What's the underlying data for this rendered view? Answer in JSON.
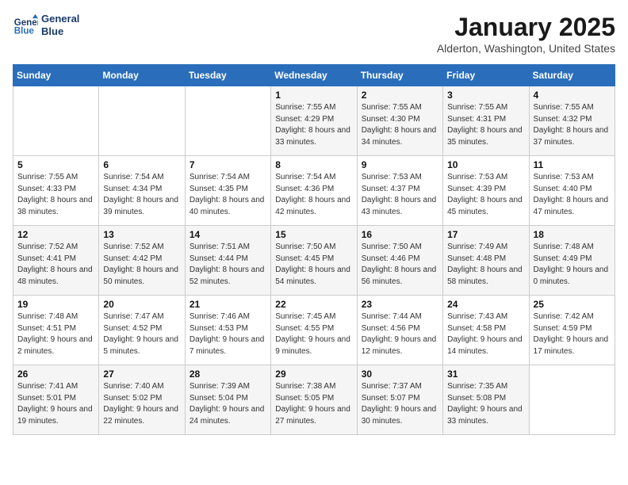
{
  "header": {
    "logo_line1": "General",
    "logo_line2": "Blue",
    "month": "January 2025",
    "location": "Alderton, Washington, United States"
  },
  "weekdays": [
    "Sunday",
    "Monday",
    "Tuesday",
    "Wednesday",
    "Thursday",
    "Friday",
    "Saturday"
  ],
  "weeks": [
    [
      {
        "day": "",
        "sunrise": "",
        "sunset": "",
        "daylight": ""
      },
      {
        "day": "",
        "sunrise": "",
        "sunset": "",
        "daylight": ""
      },
      {
        "day": "",
        "sunrise": "",
        "sunset": "",
        "daylight": ""
      },
      {
        "day": "1",
        "sunrise": "Sunrise: 7:55 AM",
        "sunset": "Sunset: 4:29 PM",
        "daylight": "Daylight: 8 hours and 33 minutes."
      },
      {
        "day": "2",
        "sunrise": "Sunrise: 7:55 AM",
        "sunset": "Sunset: 4:30 PM",
        "daylight": "Daylight: 8 hours and 34 minutes."
      },
      {
        "day": "3",
        "sunrise": "Sunrise: 7:55 AM",
        "sunset": "Sunset: 4:31 PM",
        "daylight": "Daylight: 8 hours and 35 minutes."
      },
      {
        "day": "4",
        "sunrise": "Sunrise: 7:55 AM",
        "sunset": "Sunset: 4:32 PM",
        "daylight": "Daylight: 8 hours and 37 minutes."
      }
    ],
    [
      {
        "day": "5",
        "sunrise": "Sunrise: 7:55 AM",
        "sunset": "Sunset: 4:33 PM",
        "daylight": "Daylight: 8 hours and 38 minutes."
      },
      {
        "day": "6",
        "sunrise": "Sunrise: 7:54 AM",
        "sunset": "Sunset: 4:34 PM",
        "daylight": "Daylight: 8 hours and 39 minutes."
      },
      {
        "day": "7",
        "sunrise": "Sunrise: 7:54 AM",
        "sunset": "Sunset: 4:35 PM",
        "daylight": "Daylight: 8 hours and 40 minutes."
      },
      {
        "day": "8",
        "sunrise": "Sunrise: 7:54 AM",
        "sunset": "Sunset: 4:36 PM",
        "daylight": "Daylight: 8 hours and 42 minutes."
      },
      {
        "day": "9",
        "sunrise": "Sunrise: 7:53 AM",
        "sunset": "Sunset: 4:37 PM",
        "daylight": "Daylight: 8 hours and 43 minutes."
      },
      {
        "day": "10",
        "sunrise": "Sunrise: 7:53 AM",
        "sunset": "Sunset: 4:39 PM",
        "daylight": "Daylight: 8 hours and 45 minutes."
      },
      {
        "day": "11",
        "sunrise": "Sunrise: 7:53 AM",
        "sunset": "Sunset: 4:40 PM",
        "daylight": "Daylight: 8 hours and 47 minutes."
      }
    ],
    [
      {
        "day": "12",
        "sunrise": "Sunrise: 7:52 AM",
        "sunset": "Sunset: 4:41 PM",
        "daylight": "Daylight: 8 hours and 48 minutes."
      },
      {
        "day": "13",
        "sunrise": "Sunrise: 7:52 AM",
        "sunset": "Sunset: 4:42 PM",
        "daylight": "Daylight: 8 hours and 50 minutes."
      },
      {
        "day": "14",
        "sunrise": "Sunrise: 7:51 AM",
        "sunset": "Sunset: 4:44 PM",
        "daylight": "Daylight: 8 hours and 52 minutes."
      },
      {
        "day": "15",
        "sunrise": "Sunrise: 7:50 AM",
        "sunset": "Sunset: 4:45 PM",
        "daylight": "Daylight: 8 hours and 54 minutes."
      },
      {
        "day": "16",
        "sunrise": "Sunrise: 7:50 AM",
        "sunset": "Sunset: 4:46 PM",
        "daylight": "Daylight: 8 hours and 56 minutes."
      },
      {
        "day": "17",
        "sunrise": "Sunrise: 7:49 AM",
        "sunset": "Sunset: 4:48 PM",
        "daylight": "Daylight: 8 hours and 58 minutes."
      },
      {
        "day": "18",
        "sunrise": "Sunrise: 7:48 AM",
        "sunset": "Sunset: 4:49 PM",
        "daylight": "Daylight: 9 hours and 0 minutes."
      }
    ],
    [
      {
        "day": "19",
        "sunrise": "Sunrise: 7:48 AM",
        "sunset": "Sunset: 4:51 PM",
        "daylight": "Daylight: 9 hours and 2 minutes."
      },
      {
        "day": "20",
        "sunrise": "Sunrise: 7:47 AM",
        "sunset": "Sunset: 4:52 PM",
        "daylight": "Daylight: 9 hours and 5 minutes."
      },
      {
        "day": "21",
        "sunrise": "Sunrise: 7:46 AM",
        "sunset": "Sunset: 4:53 PM",
        "daylight": "Daylight: 9 hours and 7 minutes."
      },
      {
        "day": "22",
        "sunrise": "Sunrise: 7:45 AM",
        "sunset": "Sunset: 4:55 PM",
        "daylight": "Daylight: 9 hours and 9 minutes."
      },
      {
        "day": "23",
        "sunrise": "Sunrise: 7:44 AM",
        "sunset": "Sunset: 4:56 PM",
        "daylight": "Daylight: 9 hours and 12 minutes."
      },
      {
        "day": "24",
        "sunrise": "Sunrise: 7:43 AM",
        "sunset": "Sunset: 4:58 PM",
        "daylight": "Daylight: 9 hours and 14 minutes."
      },
      {
        "day": "25",
        "sunrise": "Sunrise: 7:42 AM",
        "sunset": "Sunset: 4:59 PM",
        "daylight": "Daylight: 9 hours and 17 minutes."
      }
    ],
    [
      {
        "day": "26",
        "sunrise": "Sunrise: 7:41 AM",
        "sunset": "Sunset: 5:01 PM",
        "daylight": "Daylight: 9 hours and 19 minutes."
      },
      {
        "day": "27",
        "sunrise": "Sunrise: 7:40 AM",
        "sunset": "Sunset: 5:02 PM",
        "daylight": "Daylight: 9 hours and 22 minutes."
      },
      {
        "day": "28",
        "sunrise": "Sunrise: 7:39 AM",
        "sunset": "Sunset: 5:04 PM",
        "daylight": "Daylight: 9 hours and 24 minutes."
      },
      {
        "day": "29",
        "sunrise": "Sunrise: 7:38 AM",
        "sunset": "Sunset: 5:05 PM",
        "daylight": "Daylight: 9 hours and 27 minutes."
      },
      {
        "day": "30",
        "sunrise": "Sunrise: 7:37 AM",
        "sunset": "Sunset: 5:07 PM",
        "daylight": "Daylight: 9 hours and 30 minutes."
      },
      {
        "day": "31",
        "sunrise": "Sunrise: 7:35 AM",
        "sunset": "Sunset: 5:08 PM",
        "daylight": "Daylight: 9 hours and 33 minutes."
      },
      {
        "day": "",
        "sunrise": "",
        "sunset": "",
        "daylight": ""
      }
    ]
  ]
}
